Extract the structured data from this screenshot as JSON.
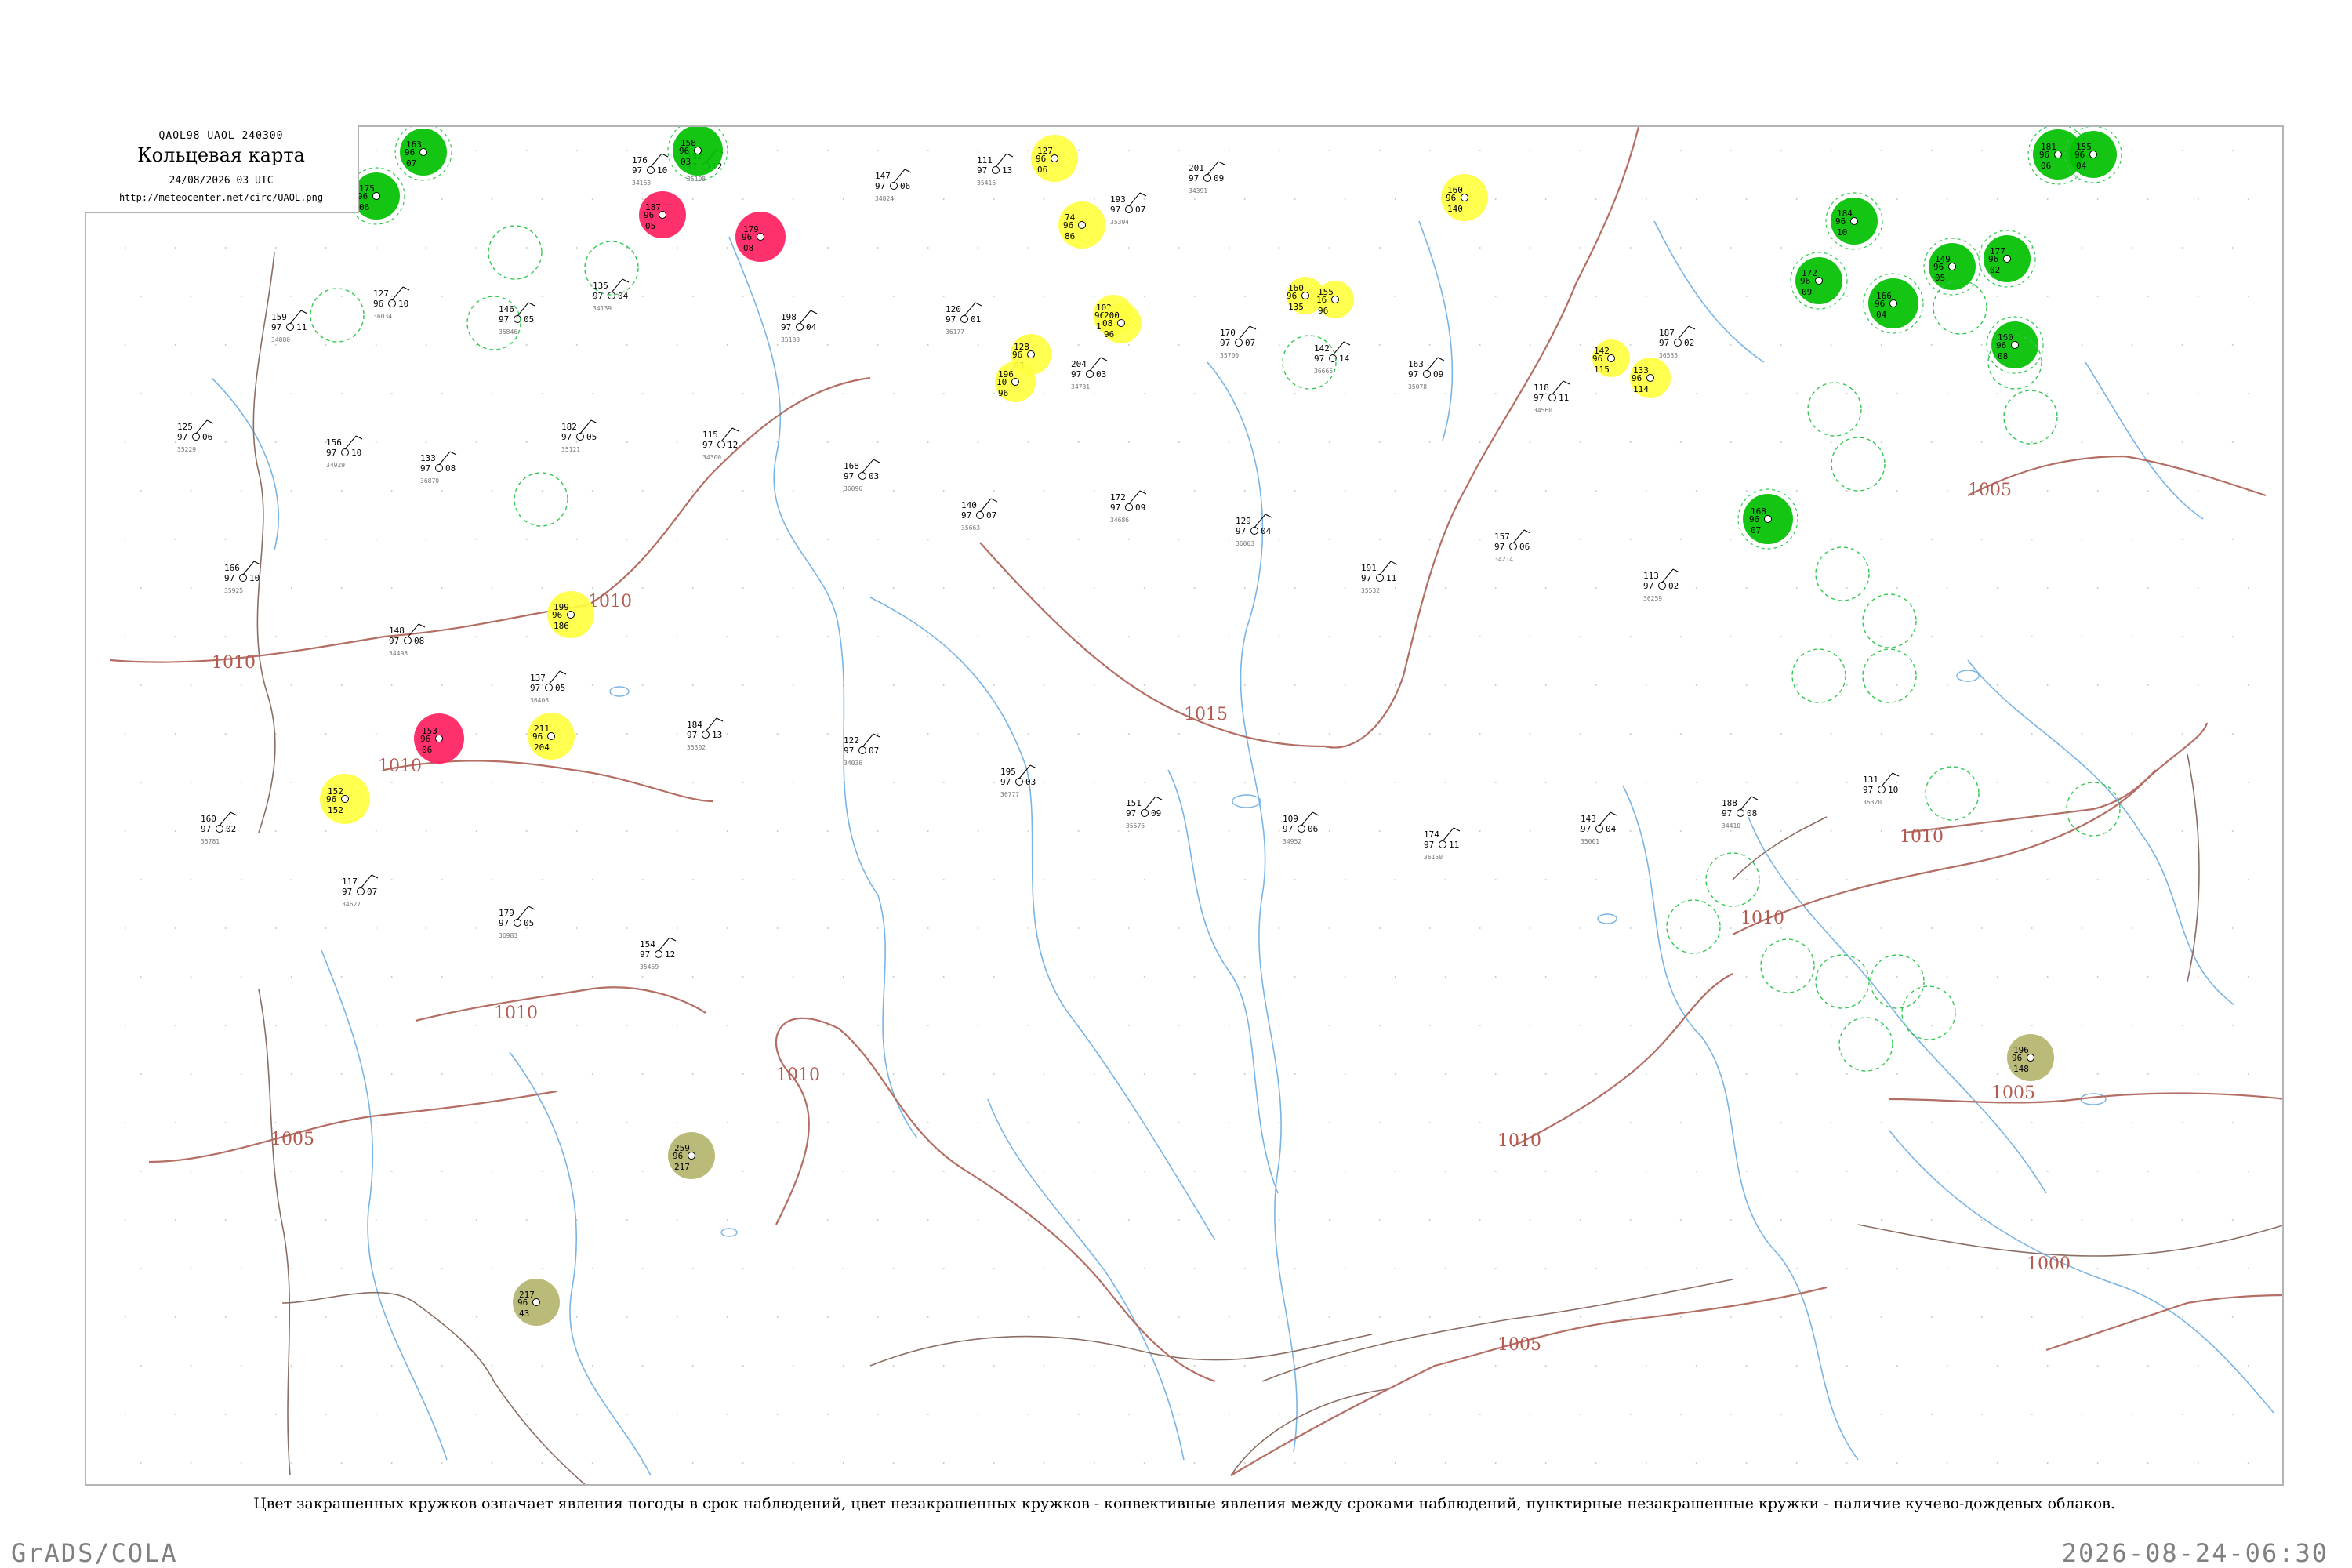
{
  "header": {
    "code": "QAOL98  UAOL  240300",
    "title": "Кольцевая карта",
    "date": "24/08/2026 03 UTC",
    "url": "http://meteocenter.net/circ/UAOL.png"
  },
  "caption": "Цвет закрашенных кружков означает явления погоды в срок наблюдений, цвет незакрашенных кружков - конвективные явления между сроками наблюдений, пунктирные незакрашенные кружки - наличие кучево-дождевых облаков.",
  "footer": {
    "left": "GrADS/COLA",
    "right": "2026-08-24-06:30"
  },
  "colors": {
    "thunderstorm": "#00c000",
    "shower": "#ffff40",
    "heavy": "#ff2060",
    "haze": "#b4b46e",
    "isobar": "#b46e64",
    "river": "#78b4e6",
    "cb_ring": "#32c850"
  },
  "isobars": [
    {
      "label": "1010"
    },
    {
      "label": "1010"
    },
    {
      "label": "1010"
    },
    {
      "label": "1010"
    },
    {
      "label": "1005"
    },
    {
      "label": "1015"
    },
    {
      "label": "1010"
    },
    {
      "label": "1005"
    },
    {
      "label": "1010"
    },
    {
      "label": "1010"
    },
    {
      "label": "1005"
    },
    {
      "label": "1000"
    },
    {
      "label": "1010"
    },
    {
      "label": "1005"
    }
  ],
  "stations": [
    {
      "id": "34163",
      "t": "176",
      "p": "97",
      "v": "10"
    },
    {
      "id": "35108",
      "t": "152",
      "p": "97",
      "v": "12"
    },
    {
      "id": "34824",
      "t": "147",
      "p": "97",
      "v": "06"
    },
    {
      "id": "35416",
      "t": "111",
      "p": "97",
      "v": "13"
    },
    {
      "id": "35394",
      "t": "193",
      "p": "97",
      "v": "07"
    },
    {
      "id": "34391",
      "t": "201",
      "p": "97",
      "v": "09"
    },
    {
      "id": "34880",
      "t": "159",
      "p": "97",
      "v": "11"
    },
    {
      "id": "36034",
      "t": "127",
      "p": "96",
      "v": "10"
    },
    {
      "id": "35846",
      "t": "146",
      "p": "97",
      "v": "05"
    },
    {
      "id": "34139",
      "t": "135",
      "p": "97",
      "v": "04"
    },
    {
      "id": "35188",
      "t": "198",
      "p": "97",
      "v": "04"
    },
    {
      "id": "36177",
      "t": "120",
      "p": "97",
      "v": "01"
    },
    {
      "id": "34731",
      "t": "204",
      "p": "97",
      "v": "03"
    },
    {
      "id": "35700",
      "t": "170",
      "p": "97",
      "v": "07"
    },
    {
      "id": "36665",
      "t": "142",
      "p": "97",
      "v": "14"
    },
    {
      "id": "35078",
      "t": "163",
      "p": "97",
      "v": "09"
    },
    {
      "id": "34560",
      "t": "118",
      "p": "97",
      "v": "11"
    },
    {
      "id": "36535",
      "t": "187",
      "p": "97",
      "v": "02"
    },
    {
      "id": "35229",
      "t": "125",
      "p": "97",
      "v": "06"
    },
    {
      "id": "34929",
      "t": "156",
      "p": "97",
      "v": "10"
    },
    {
      "id": "36870",
      "t": "133",
      "p": "97",
      "v": "08"
    },
    {
      "id": "35121",
      "t": "182",
      "p": "97",
      "v": "05"
    },
    {
      "id": "34300",
      "t": "115",
      "p": "97",
      "v": "12"
    },
    {
      "id": "36096",
      "t": "168",
      "p": "97",
      "v": "03"
    },
    {
      "id": "35663",
      "t": "140",
      "p": "97",
      "v": "07"
    },
    {
      "id": "34686",
      "t": "172",
      "p": "97",
      "v": "09"
    },
    {
      "id": "36003",
      "t": "129",
      "p": "97",
      "v": "04"
    },
    {
      "id": "35532",
      "t": "191",
      "p": "97",
      "v": "11"
    },
    {
      "id": "34214",
      "t": "157",
      "p": "97",
      "v": "06"
    },
    {
      "id": "36259",
      "t": "113",
      "p": "97",
      "v": "02"
    },
    {
      "id": "35925",
      "t": "166",
      "p": "97",
      "v": "10"
    },
    {
      "id": "34498",
      "t": "148",
      "p": "97",
      "v": "08"
    },
    {
      "id": "36408",
      "t": "137",
      "p": "97",
      "v": "05"
    },
    {
      "id": "35302",
      "t": "184",
      "p": "97",
      "v": "13"
    },
    {
      "id": "34036",
      "t": "122",
      "p": "97",
      "v": "07"
    },
    {
      "id": "36777",
      "t": "195",
      "p": "97",
      "v": "03"
    },
    {
      "id": "35576",
      "t": "151",
      "p": "97",
      "v": "09"
    },
    {
      "id": "34952",
      "t": "109",
      "p": "97",
      "v": "06"
    },
    {
      "id": "36150",
      "t": "174",
      "p": "97",
      "v": "11"
    },
    {
      "id": "35001",
      "t": "143",
      "p": "97",
      "v": "04"
    },
    {
      "id": "34410",
      "t": "188",
      "p": "97",
      "v": "08"
    },
    {
      "id": "36320",
      "t": "131",
      "p": "97",
      "v": "10"
    },
    {
      "id": "35781",
      "t": "160",
      "p": "97",
      "v": "02"
    },
    {
      "id": "34627",
      "t": "117",
      "p": "97",
      "v": "07"
    },
    {
      "id": "36983",
      "t": "179",
      "p": "97",
      "v": "05"
    },
    {
      "id": "35459",
      "t": "154",
      "p": "97",
      "v": "12"
    }
  ],
  "weather_circles": [
    {
      "kind": "thunderstorm",
      "t": "163",
      "p": "96",
      "v": "07"
    },
    {
      "kind": "thunderstorm",
      "t": "175",
      "p": "96",
      "v": "06"
    },
    {
      "kind": "thunderstorm",
      "t": "158",
      "p": "96",
      "v": "03"
    },
    {
      "kind": "thunderstorm",
      "t": "184",
      "p": "96",
      "v": "10"
    },
    {
      "kind": "thunderstorm",
      "t": "172",
      "p": "96",
      "v": "09"
    },
    {
      "kind": "thunderstorm",
      "t": "166",
      "p": "96",
      "v": "04"
    },
    {
      "kind": "thunderstorm",
      "t": "149",
      "p": "96",
      "v": "05"
    },
    {
      "kind": "thunderstorm",
      "t": "177",
      "p": "96",
      "v": "02"
    },
    {
      "kind": "thunderstorm",
      "t": "160",
      "p": "96",
      "v": "08"
    },
    {
      "kind": "thunderstorm",
      "t": "181",
      "p": "96",
      "v": "06"
    },
    {
      "kind": "thunderstorm",
      "t": "155",
      "p": "96",
      "v": "04"
    },
    {
      "kind": "thunderstorm",
      "t": "168",
      "p": "96",
      "v": "07"
    },
    {
      "kind": "heavy",
      "t": "187",
      "p": "96",
      "v": "05"
    },
    {
      "kind": "heavy",
      "t": "179",
      "p": "96",
      "v": "08"
    },
    {
      "kind": "heavy",
      "t": "153",
      "p": "96",
      "v": "06"
    },
    {
      "kind": "shower",
      "t": "127",
      "p": "96",
      "v": "06"
    },
    {
      "kind": "shower",
      "t": "102",
      "p": "96",
      "v": "10"
    },
    {
      "kind": "shower",
      "t": "200",
      "p": "08",
      "v": "96"
    },
    {
      "kind": "shower",
      "t": "74",
      "p": "96",
      "v": "86"
    },
    {
      "kind": "shower",
      "t": "128",
      "p": "96",
      "v": "03"
    },
    {
      "kind": "shower",
      "t": "196",
      "p": "10",
      "v": "96"
    },
    {
      "kind": "shower",
      "t": "160",
      "p": "96",
      "v": "135"
    },
    {
      "kind": "shower",
      "t": "155",
      "p": "16",
      "v": "96"
    },
    {
      "kind": "shower",
      "t": "160",
      "p": "96",
      "v": "140"
    },
    {
      "kind": "shower",
      "t": "142",
      "p": "96",
      "v": "115"
    },
    {
      "kind": "shower",
      "t": "133",
      "p": "96",
      "v": "114"
    },
    {
      "kind": "shower",
      "t": "199",
      "p": "96",
      "v": "186"
    },
    {
      "kind": "shower",
      "t": "152",
      "p": "96",
      "v": "152"
    },
    {
      "kind": "shower",
      "t": "211",
      "p": "96",
      "v": "204"
    },
    {
      "kind": "haze",
      "t": "217",
      "p": "96",
      "v": "43"
    },
    {
      "kind": "haze",
      "t": "259",
      "p": "96",
      "v": "217"
    },
    {
      "kind": "haze",
      "t": "196",
      "p": "96",
      "v": "148"
    }
  ],
  "cb_rings": [
    {
      "kind": "cb"
    },
    {
      "kind": "cb"
    },
    {
      "kind": "cb"
    },
    {
      "kind": "cb"
    },
    {
      "kind": "cb"
    },
    {
      "kind": "cb"
    },
    {
      "kind": "cb"
    },
    {
      "kind": "cb"
    },
    {
      "kind": "cb"
    },
    {
      "kind": "cb"
    },
    {
      "kind": "cb"
    },
    {
      "kind": "cb"
    },
    {
      "kind": "cb"
    },
    {
      "kind": "cb"
    },
    {
      "kind": "cb"
    },
    {
      "kind": "cb"
    },
    {
      "kind": "cb"
    },
    {
      "kind": "cb"
    },
    {
      "kind": "cb"
    },
    {
      "kind": "cb"
    },
    {
      "kind": "cb"
    },
    {
      "kind": "cb"
    },
    {
      "kind": "cb"
    },
    {
      "kind": "cb"
    }
  ]
}
